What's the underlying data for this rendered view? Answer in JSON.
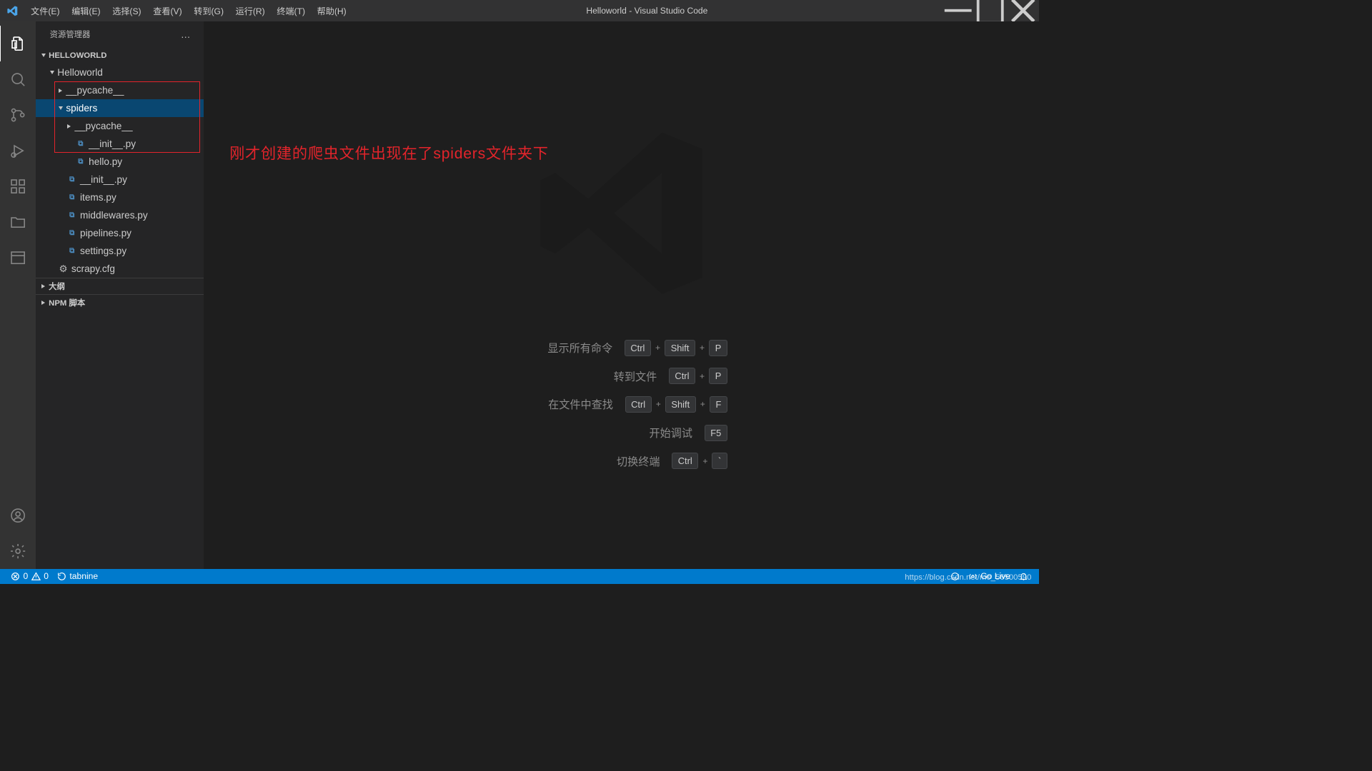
{
  "title": "Helloworld - Visual Studio Code",
  "menubar": [
    "文件(E)",
    "编辑(E)",
    "选择(S)",
    "查看(V)",
    "转到(G)",
    "运行(R)",
    "终端(T)",
    "帮助(H)"
  ],
  "sidebar": {
    "title": "资源管理器",
    "more": "…",
    "workspace": "HELLOWORLD",
    "tree": {
      "helloworld_folder": "Helloworld",
      "pycache1": "__pycache__",
      "spiders": "spiders",
      "pycache2": "__pycache__",
      "init_spiders": "__init__.py",
      "hello": "hello.py",
      "init_root": "__init__.py",
      "items": "items.py",
      "middlewares": "middlewares.py",
      "pipelines": "pipelines.py",
      "settings": "settings.py",
      "scrapy": "scrapy.cfg"
    },
    "outline": "大纲",
    "npm": "NPM 脚本"
  },
  "annotation": "刚才创建的爬虫文件出现在了spiders文件夹下",
  "shortcuts": [
    {
      "label": "显示所有命令",
      "keys": [
        "Ctrl",
        "Shift",
        "P"
      ]
    },
    {
      "label": "转到文件",
      "keys": [
        "Ctrl",
        "P"
      ]
    },
    {
      "label": "在文件中查找",
      "keys": [
        "Ctrl",
        "Shift",
        "F"
      ]
    },
    {
      "label": "开始调试",
      "keys": [
        "F5"
      ]
    },
    {
      "label": "切换终端",
      "keys": [
        "Ctrl",
        "`"
      ]
    }
  ],
  "status": {
    "errors": "0",
    "warnings": "0",
    "tabnine": "tabnine",
    "golive": "Go Live",
    "watermark": "https://blog.csdn.net/m0_56500590"
  }
}
